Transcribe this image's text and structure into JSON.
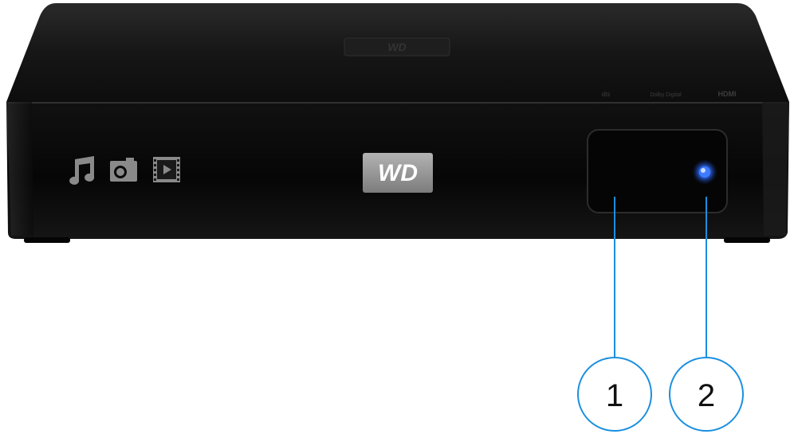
{
  "device": {
    "brand_logo_text": "WD",
    "top_badges": [
      "dts",
      "Dolby Digital",
      "HDMI"
    ],
    "media_icons": [
      "music-note-icon",
      "camera-photo-icon",
      "film-play-icon"
    ],
    "power_led_color": "#2f6bff"
  },
  "callouts": [
    {
      "number": "1",
      "target": "ir-receiver-window"
    },
    {
      "number": "2",
      "target": "power-led"
    }
  ],
  "colors": {
    "callout_line": "#1a8fe0",
    "callout_circle": "#1a8fe0",
    "device_body": "#0b0b0b",
    "logo_plate": "#9a9a9a"
  }
}
